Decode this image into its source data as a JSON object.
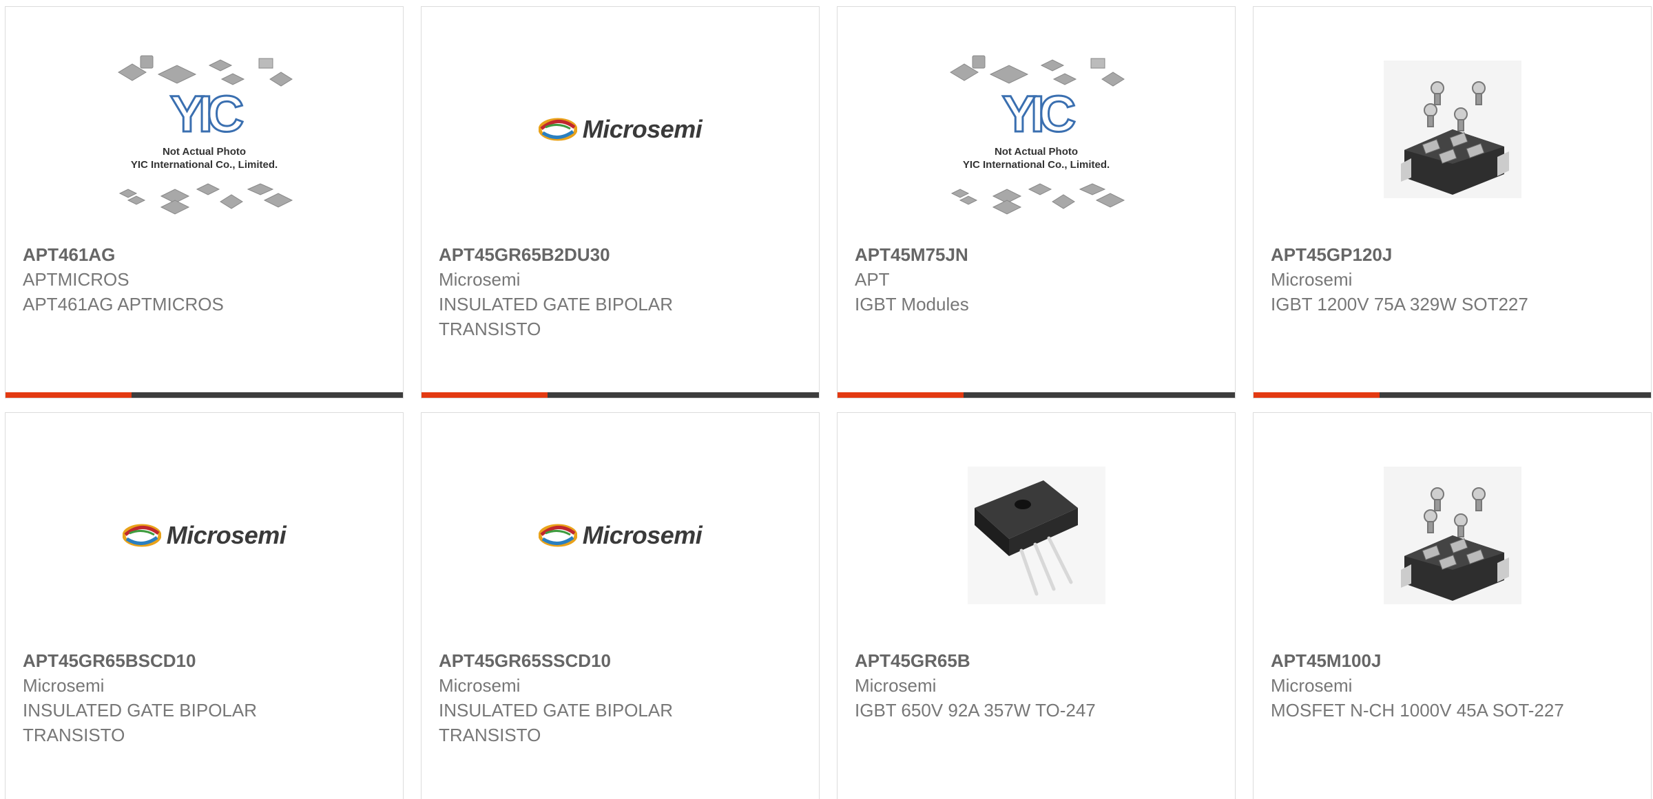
{
  "products": [
    {
      "part": "APT461AG",
      "manufacturer": "APTMICROS",
      "description": "APT461AG APTMICROS",
      "image": "yic-placeholder"
    },
    {
      "part": "APT45GR65B2DU30",
      "manufacturer": "Microsemi",
      "description": "INSULATED GATE BIPOLAR TRANSISTO",
      "image": "microsemi-logo"
    },
    {
      "part": "APT45M75JN",
      "manufacturer": "APT",
      "description": "IGBT Modules",
      "image": "yic-placeholder"
    },
    {
      "part": "APT45GP120J",
      "manufacturer": "Microsemi",
      "description": "IGBT 1200V 75A 329W SOT227",
      "image": "sot227-module"
    },
    {
      "part": "APT45GR65BSCD10",
      "manufacturer": "Microsemi",
      "description": "INSULATED GATE BIPOLAR TRANSISTO",
      "image": "microsemi-logo"
    },
    {
      "part": "APT45GR65SSCD10",
      "manufacturer": "Microsemi",
      "description": "INSULATED GATE BIPOLAR TRANSISTO",
      "image": "microsemi-logo"
    },
    {
      "part": "APT45GR65B",
      "manufacturer": "Microsemi",
      "description": "IGBT 650V 92A 357W TO-247",
      "image": "to247-package"
    },
    {
      "part": "APT45M100J",
      "manufacturer": "Microsemi",
      "description": "MOSFET N-CH 1000V 45A SOT-227",
      "image": "sot227-module"
    }
  ],
  "placeholder": {
    "logo_text": "YIC",
    "caption_line1": "Not Actual Photo",
    "caption_line2": "YIC International Co., Limited."
  },
  "microsemi_logo": {
    "wordmark": "Microsemi"
  },
  "colors": {
    "accent": "#e33a12",
    "bar": "#3d3d3d",
    "border": "#dcdcdc",
    "text": "#666666"
  }
}
